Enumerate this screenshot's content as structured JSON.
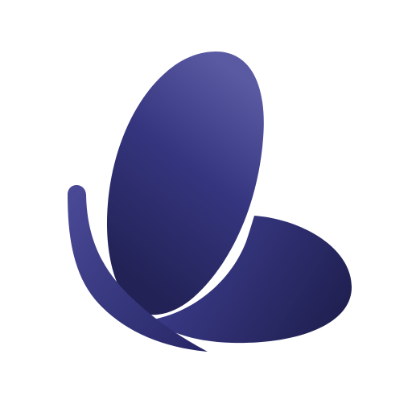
{
  "logo": {
    "subject": "butterfly",
    "colors": {
      "background": "#ffffff",
      "wing_light": "#5a5aa3",
      "wing_mid": "#35357f",
      "wing_dark": "#222256",
      "lower_wing_light": "#3b3b8a",
      "lower_wing_dark": "#202052",
      "tail_light": "#4a4a98",
      "tail_dark": "#262666"
    }
  }
}
